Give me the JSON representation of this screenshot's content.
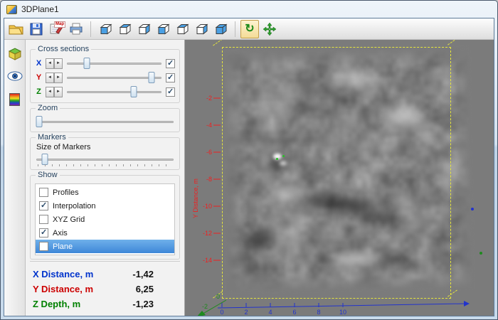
{
  "window": {
    "title": "3DPlane1"
  },
  "toolbar": {
    "report_tag": "Map",
    "icons": [
      "folder-open-icon",
      "floppy-disk-icon",
      "report-pen-icon",
      "printer-icon",
      "cube-icon",
      "rotate-icon",
      "pan-arrows-icon"
    ],
    "view_cubes": [
      {
        "name": "view-cube-1-button",
        "face": "front"
      },
      {
        "name": "view-cube-2-button",
        "face": "top"
      },
      {
        "name": "view-cube-3-button",
        "face": "side"
      },
      {
        "name": "view-cube-4-button",
        "face": "front"
      },
      {
        "name": "view-cube-5-button",
        "face": "top"
      },
      {
        "name": "view-cube-6-button",
        "face": "side"
      },
      {
        "name": "view-cube-7-button",
        "face": "all"
      }
    ],
    "rotate_pressed": true
  },
  "panel": {
    "cross_sections": {
      "title": "Cross sections",
      "rows": [
        {
          "label": "X",
          "color": "#0033cc",
          "checked": true,
          "pos": 22
        },
        {
          "label": "Y",
          "color": "#cc0000",
          "checked": true,
          "pos": 88
        },
        {
          "label": "Z",
          "color": "#008000",
          "checked": true,
          "pos": 70
        }
      ]
    },
    "zoom": {
      "title": "Zoom",
      "pos": 3
    },
    "markers": {
      "title": "Markers",
      "label": "Size of Markers",
      "pos": 7
    },
    "show": {
      "title": "Show",
      "items": [
        {
          "label": "Profiles",
          "checked": false,
          "selected": false
        },
        {
          "label": "Interpolation",
          "checked": true,
          "selected": false
        },
        {
          "label": "XYZ Grid",
          "checked": false,
          "selected": false
        },
        {
          "label": "Axis",
          "checked": true,
          "selected": false
        },
        {
          "label": "Plane",
          "checked": false,
          "selected": true
        }
      ]
    },
    "readouts": [
      {
        "label": "X Distance, m",
        "value": "-1,42",
        "color": "#0033cc"
      },
      {
        "label": "Y Distance, m",
        "value": "6,25",
        "color": "#cc0000"
      },
      {
        "label": "Z Depth, m",
        "value": "-1,23",
        "color": "#008000"
      }
    ]
  },
  "viewport": {
    "background": "#7b7b7b",
    "box_color": "#e6e63c",
    "y_axis": {
      "label": "Y Distance, m",
      "color": "#ee2020",
      "ticks": [
        "-2",
        "-4",
        "-6",
        "-8",
        "-10",
        "-12",
        "-14"
      ]
    },
    "x_axis": {
      "color": "#2233cc",
      "ticks": [
        "0",
        "2",
        "4",
        "6",
        "8",
        "10"
      ]
    },
    "z_axis": {
      "color": "#1e8a1e",
      "ticks": [
        "0",
        "-2"
      ]
    }
  }
}
